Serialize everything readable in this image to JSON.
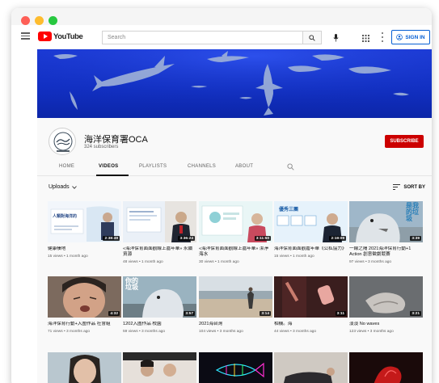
{
  "masthead": {
    "logo_text": "YouTube",
    "search_placeholder": "Search",
    "signin_label": "SIGN IN"
  },
  "channel": {
    "name": "海洋保育署OCA",
    "subscribers": "324 subscribers",
    "subscribe_label": "SUBSCRIBE"
  },
  "tabs": [
    "HOME",
    "VIDEOS",
    "PLAYLISTS",
    "CHANNELS",
    "ABOUT"
  ],
  "active_tab": "VIDEOS",
  "uploads": {
    "label": "Uploads",
    "sort_label": "SORT BY"
  },
  "videos": [
    {
      "title": "健康棲地",
      "meta": "15 views • 1 month ago",
      "duration": "2:38:49"
    },
    {
      "title": "«海洋保育面面觀線上嘉年華» 永續資源",
      "meta": "48 views • 1 month ago",
      "duration": "3:36:24"
    },
    {
      "title": "«海洋保育面面觀線上嘉年華» 潔淨海水",
      "meta": "30 views • 1 month ago",
      "duration": "3:11:50"
    },
    {
      "title": "海洋保育面面觀嘉年華《公私協力》",
      "meta": "15 views • 1 month ago",
      "duration": "2:19:09"
    },
    {
      "title": "一線之隔 2021海洋保育行動+1 Action 創意徵劇競賽",
      "meta": "97 views • 3 months ago",
      "duration": "3:39"
    },
    {
      "title": "海洋保育行動+入圍作品 社會組",
      "meta": "71 views • 3 months ago",
      "duration": "4:32"
    },
    {
      "title": "1202入圍作品 校園",
      "meta": "59 views • 3 months ago",
      "duration": "3:57"
    },
    {
      "title": "2021海台灣",
      "meta": "104 views • 3 months ago",
      "duration": "3:14"
    },
    {
      "title": "相機。海",
      "meta": "44 views • 3 months ago",
      "duration": "3:11"
    },
    {
      "title": "淡淡 No waves",
      "meta": "123 views • 3 months ago",
      "duration": "3:21"
    }
  ],
  "thumb_text": {
    "poster_chars": "你的垃圾",
    "poster_chars_b": "是我的垃圾",
    "card1_caption": "人類對海洋的",
    "card4_heading": "優秀三團"
  },
  "icons": {
    "menu": "hamburger-menu-icon",
    "search": "magnifier-icon",
    "mic": "microphone-icon",
    "apps": "apps-grid-icon",
    "more": "kebab-menu-icon",
    "account": "account-circle-icon",
    "sort": "sort-lines-icon"
  },
  "colors": {
    "brand_red": "#ff0000",
    "subscribe_red": "#cc0000",
    "link_blue": "#065fd4",
    "banner_blue": "#1c3ad8"
  }
}
